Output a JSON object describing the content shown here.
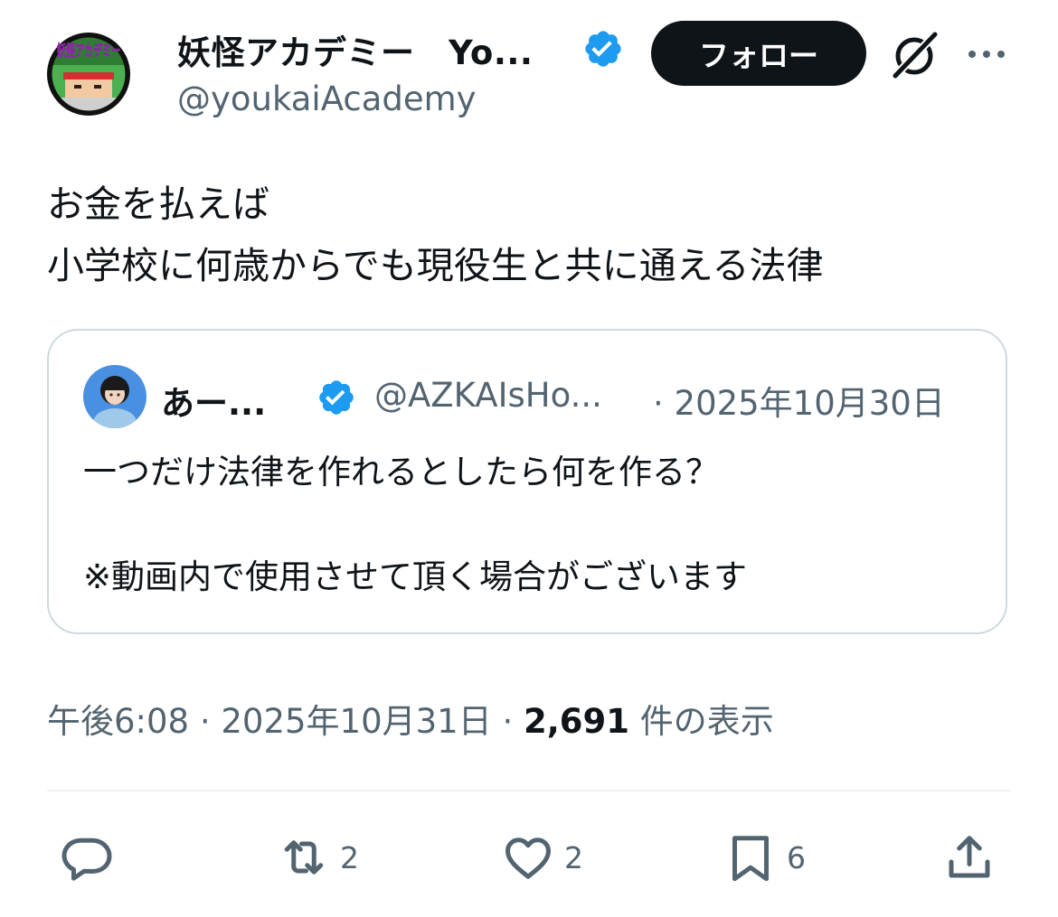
{
  "tweet": {
    "author": {
      "display_name": "妖怪アカデミー　Yo...",
      "handle": "@youkaiAcademy",
      "avatar_text": "妖怪アカデミー",
      "verified": true
    },
    "follow_label": "フォロー",
    "text_lines": [
      "お金を払えば",
      "小学校に何歳からでも現役生と共に通える法律"
    ],
    "quoted": {
      "display_name": "あー...",
      "verified": true,
      "handle": "@AZKAIsHo...",
      "date": "· 2025年10月30日",
      "text_lines": [
        "一つだけ法律を作れるとしたら何を作る？",
        "",
        "※動画内で使用させて頂く場合がございます"
      ]
    },
    "meta": {
      "time": "午後6:08 · 2025年10月31日 · ",
      "views_count": "2,691",
      "views_label": " 件の表示"
    },
    "actions": {
      "reply_count": "",
      "retweet_count": "2",
      "like_count": "2",
      "bookmark_count": "6"
    }
  },
  "colors": {
    "text_primary": "#0f1419",
    "text_secondary": "#536471",
    "verified_blue": "#1d9bf0",
    "border": "#cfd9de",
    "follow_bg": "#0f1419"
  }
}
